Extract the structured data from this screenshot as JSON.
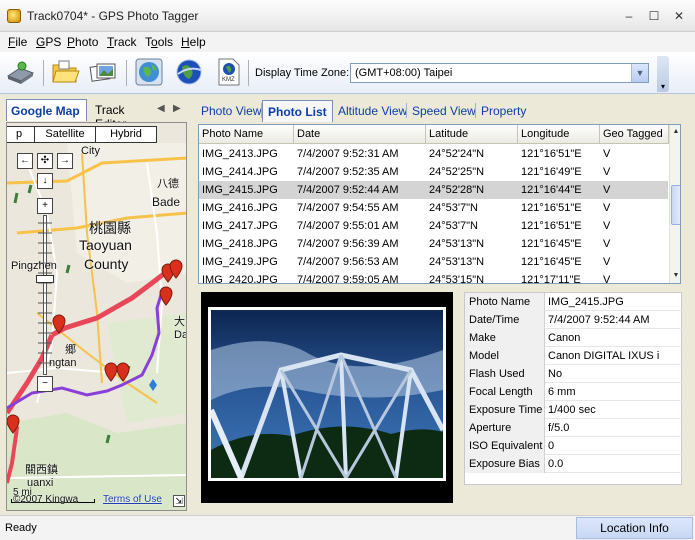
{
  "window": {
    "title": "Track0704* - GPS Photo Tagger",
    "minimize": "–",
    "maximize": "☐",
    "close": "✕"
  },
  "menu": [
    {
      "prefix": "",
      "accel": "F",
      "rest": "ile"
    },
    {
      "prefix": "",
      "accel": "G",
      "rest": "PS"
    },
    {
      "prefix": "",
      "accel": "P",
      "rest": "hoto"
    },
    {
      "prefix": "",
      "accel": "T",
      "rest": "rack"
    },
    {
      "prefix": "T",
      "accel": "o",
      "rest": "ols"
    },
    {
      "prefix": "",
      "accel": "H",
      "rest": "elp"
    }
  ],
  "toolbar": {
    "timezone_label": "Display Time Zone:",
    "timezone_value": "(GMT+08:00) Taipei",
    "kmz_label": "KMZ"
  },
  "left_tabs": {
    "google_map": "Google Map",
    "track_editor": "Track Editor"
  },
  "map": {
    "type_buttons": [
      "p",
      "Satellite",
      "Hybrid"
    ],
    "labels": {
      "city": "City",
      "eight": "八德",
      "bade": "Bade",
      "taoyuan_cn": "桃園縣",
      "taoyuan_en": "Taoyuan",
      "county": "County",
      "pingzhen": "Pingzhen",
      "hsiang": "郷",
      "ngtan": "ngtan",
      "guanxi_cn": "關西鎮",
      "guanxi_en": "uanxi",
      "da": "大",
      "da2": "Da",
      "copyright": "©2007 Kingwa",
      "terms": "Terms of Use",
      "scale": "5 mi"
    }
  },
  "right_tabs": [
    "Photo View",
    "Photo List",
    "Altitude View",
    "Speed View",
    "Property"
  ],
  "photo_list": {
    "columns": [
      "Photo Name",
      "Date",
      "Latitude",
      "Longitude",
      "Geo Tagged"
    ],
    "rows": [
      [
        "IMG_2413.JPG",
        "7/4/2007 9:52:31 AM",
        "24°52'24\"N",
        "121°16'51\"E",
        "V"
      ],
      [
        "IMG_2414.JPG",
        "7/4/2007 9:52:35 AM",
        "24°52'25\"N",
        "121°16'49\"E",
        "V"
      ],
      [
        "IMG_2415.JPG",
        "7/4/2007 9:52:44 AM",
        "24°52'28\"N",
        "121°16'44\"E",
        "V"
      ],
      [
        "IMG_2416.JPG",
        "7/4/2007 9:54:55 AM",
        "24°53'7\"N",
        "121°16'51\"E",
        "V"
      ],
      [
        "IMG_2417.JPG",
        "7/4/2007 9:55:01 AM",
        "24°53'7\"N",
        "121°16'51\"E",
        "V"
      ],
      [
        "IMG_2418.JPG",
        "7/4/2007 9:56:39 AM",
        "24°53'13\"N",
        "121°16'45\"E",
        "V"
      ],
      [
        "IMG_2419.JPG",
        "7/4/2007 9:56:53 AM",
        "24°53'13\"N",
        "121°16'45\"E",
        "V"
      ],
      [
        "IMG_2420.JPG",
        "7/4/2007 9:59:05 AM",
        "24°53'15\"N",
        "121°17'11\"E",
        "V"
      ]
    ],
    "selected_row": 2
  },
  "properties": [
    {
      "label": "Photo Name",
      "value": "IMG_2415.JPG"
    },
    {
      "label": "Date/Time",
      "value": "7/4/2007 9:52:44 AM"
    },
    {
      "label": "Make",
      "value": "Canon"
    },
    {
      "label": "Model",
      "value": "Canon DIGITAL IXUS i"
    },
    {
      "label": "Flash Used",
      "value": "No"
    },
    {
      "label": "Focal Length",
      "value": "6 mm"
    },
    {
      "label": "Exposure Time",
      "value": "1/400 sec"
    },
    {
      "label": "Aperture",
      "value": "f/5.0"
    },
    {
      "label": "ISO Equivalent",
      "value": "0"
    },
    {
      "label": "Exposure Bias",
      "value": "0.0"
    }
  ],
  "status": {
    "text": "Ready",
    "location_info": "Location Info"
  }
}
